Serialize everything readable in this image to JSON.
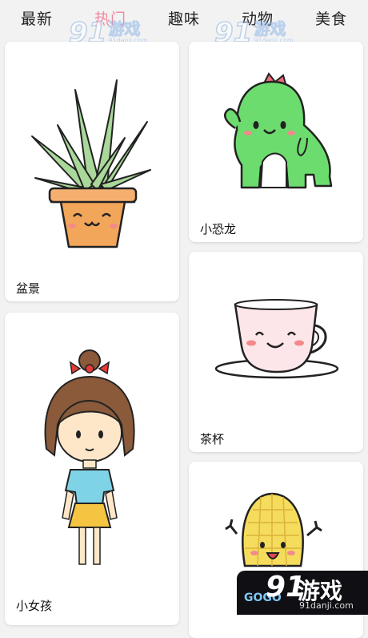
{
  "tabs": [
    {
      "label": "最新",
      "active": false
    },
    {
      "label": "热门",
      "active": true
    },
    {
      "label": "趣味",
      "active": false
    },
    {
      "label": "动物",
      "active": false
    },
    {
      "label": "美食",
      "active": false
    }
  ],
  "watermark": {
    "number": "91",
    "name": "游戏",
    "url": "91danji.com"
  },
  "cards": [
    {
      "label": "盆景",
      "icon": "potted-aloe-icon"
    },
    {
      "label": "小恐龙",
      "icon": "dinosaur-icon"
    },
    {
      "label": "小女孩",
      "icon": "girl-icon"
    },
    {
      "label": "茶杯",
      "icon": "teacup-icon"
    },
    {
      "label": "",
      "icon": "corn-icon"
    }
  ],
  "corner_logo": {
    "number": "91",
    "name": "游戏",
    "brand": "GOGO",
    "url": "91danji.com"
  },
  "colors": {
    "active_tab": "#f08aa0",
    "dino_green": "#6ddc6f",
    "shirt_blue": "#7fd3e6",
    "skirt_yellow": "#f5c542",
    "pot_orange": "#f2a65a",
    "corn_yellow": "#f6dc5c"
  }
}
